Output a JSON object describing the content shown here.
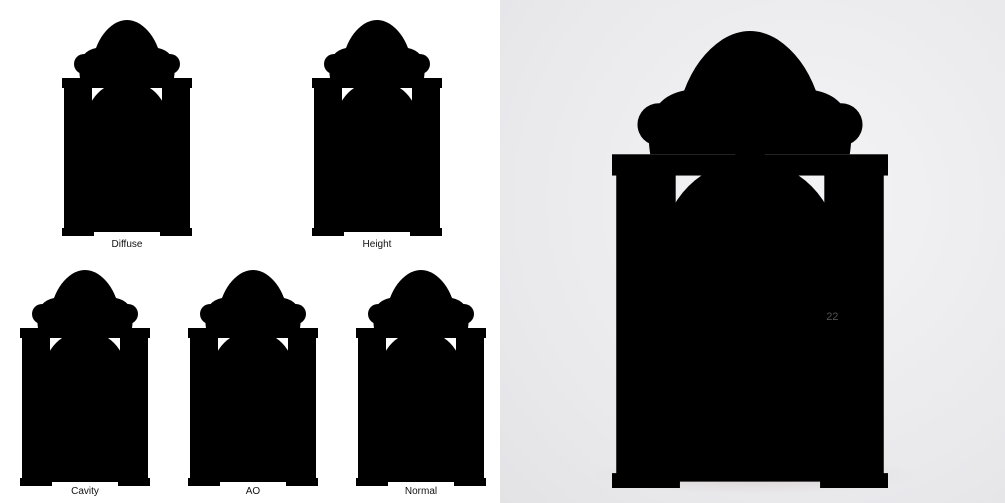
{
  "captions": {
    "diffuse": "Diffuse",
    "height": "Height",
    "cavity": "Cavity",
    "ao": "AO",
    "normal": "Normal"
  },
  "door_number": "22",
  "colors": {
    "diffuse_stone": "#a9a6a2",
    "diffuse_wood": "#7a4a24",
    "height_stone": "#d2d2d2",
    "height_wood": "#2e2e2e",
    "cavity_stone": "#f3f3f3",
    "ao_stone": "#dcdcdc",
    "normal_base": "#8a7cf0",
    "photo_stone": "#b9b5b0",
    "photo_wood": "#8b522a"
  }
}
